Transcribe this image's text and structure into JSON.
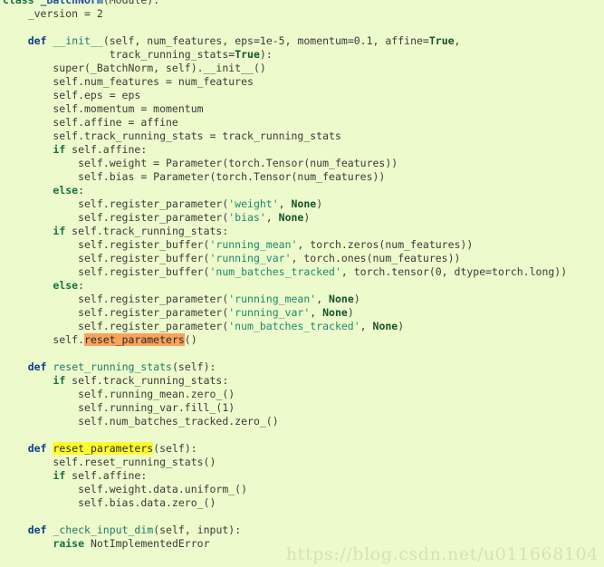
{
  "editor": {
    "background_color": "#edfacb",
    "language": "python",
    "highlight_colors": {
      "selection_orange": "#f8a25b",
      "selection_yellow": "#ffff2e"
    }
  },
  "watermark": {
    "text": "https://blog.csdn.net/u011668104",
    "color": "#d9e2b4"
  },
  "code": {
    "lines": [
      [
        {
          "t": "class",
          "c": "kw"
        },
        {
          "t": " ",
          "c": "plain"
        },
        {
          "t": "_BatchNorm",
          "c": "cls"
        },
        {
          "t": "(Module):",
          "c": "plain"
        }
      ],
      [
        {
          "t": "    _version = ",
          "c": "plain"
        },
        {
          "t": "2",
          "c": "num"
        }
      ],
      [],
      [
        {
          "t": "    ",
          "c": "plain"
        },
        {
          "t": "def",
          "c": "kwdef"
        },
        {
          "t": " ",
          "c": "plain"
        },
        {
          "t": "__init__",
          "c": "fn"
        },
        {
          "t": "(self, num_features, eps=1e-5, momentum=0.1, affine=",
          "c": "plain"
        },
        {
          "t": "True",
          "c": "const"
        },
        {
          "t": ",",
          "c": "plain"
        }
      ],
      [
        {
          "t": "                 track_running_stats=",
          "c": "plain"
        },
        {
          "t": "True",
          "c": "const"
        },
        {
          "t": "):",
          "c": "plain"
        }
      ],
      [
        {
          "t": "        super(_BatchNorm, self).__init__()",
          "c": "plain"
        }
      ],
      [
        {
          "t": "        self.num_features = num_features",
          "c": "plain"
        }
      ],
      [
        {
          "t": "        self.eps = eps",
          "c": "plain"
        }
      ],
      [
        {
          "t": "        self.momentum = momentum",
          "c": "plain"
        }
      ],
      [
        {
          "t": "        self.affine = affine",
          "c": "plain"
        }
      ],
      [
        {
          "t": "        self.track_running_stats = track_running_stats",
          "c": "plain"
        }
      ],
      [
        {
          "t": "        ",
          "c": "plain"
        },
        {
          "t": "if",
          "c": "kw"
        },
        {
          "t": " self.affine:",
          "c": "plain"
        }
      ],
      [
        {
          "t": "            self.weight = Parameter(torch.Tensor(num_features))",
          "c": "plain"
        }
      ],
      [
        {
          "t": "            self.bias = Parameter(torch.Tensor(num_features))",
          "c": "plain"
        }
      ],
      [
        {
          "t": "        ",
          "c": "plain"
        },
        {
          "t": "else",
          "c": "kw"
        },
        {
          "t": ":",
          "c": "plain"
        }
      ],
      [
        {
          "t": "            self.register_parameter(",
          "c": "plain"
        },
        {
          "t": "'weight'",
          "c": "str"
        },
        {
          "t": ", ",
          "c": "plain"
        },
        {
          "t": "None",
          "c": "const"
        },
        {
          "t": ")",
          "c": "plain"
        }
      ],
      [
        {
          "t": "            self.register_parameter(",
          "c": "plain"
        },
        {
          "t": "'bias'",
          "c": "str"
        },
        {
          "t": ", ",
          "c": "plain"
        },
        {
          "t": "None",
          "c": "const"
        },
        {
          "t": ")",
          "c": "plain"
        }
      ],
      [
        {
          "t": "        ",
          "c": "plain"
        },
        {
          "t": "if",
          "c": "kw"
        },
        {
          "t": " self.track_running_stats:",
          "c": "plain"
        }
      ],
      [
        {
          "t": "            self.register_buffer(",
          "c": "plain"
        },
        {
          "t": "'running_mean'",
          "c": "str"
        },
        {
          "t": ", torch.zeros(num_features))",
          "c": "plain"
        }
      ],
      [
        {
          "t": "            self.register_buffer(",
          "c": "plain"
        },
        {
          "t": "'running_var'",
          "c": "str"
        },
        {
          "t": ", torch.ones(num_features))",
          "c": "plain"
        }
      ],
      [
        {
          "t": "            self.register_buffer(",
          "c": "plain"
        },
        {
          "t": "'num_batches_tracked'",
          "c": "str"
        },
        {
          "t": ", torch.tensor(0, dtype=torch.long))",
          "c": "plain"
        }
      ],
      [
        {
          "t": "        ",
          "c": "plain"
        },
        {
          "t": "else",
          "c": "kw"
        },
        {
          "t": ":",
          "c": "plain"
        }
      ],
      [
        {
          "t": "            self.register_parameter(",
          "c": "plain"
        },
        {
          "t": "'running_mean'",
          "c": "str"
        },
        {
          "t": ", ",
          "c": "plain"
        },
        {
          "t": "None",
          "c": "const"
        },
        {
          "t": ")",
          "c": "plain"
        }
      ],
      [
        {
          "t": "            self.register_parameter(",
          "c": "plain"
        },
        {
          "t": "'running_var'",
          "c": "str"
        },
        {
          "t": ", ",
          "c": "plain"
        },
        {
          "t": "None",
          "c": "const"
        },
        {
          "t": ")",
          "c": "plain"
        }
      ],
      [
        {
          "t": "            self.register_parameter(",
          "c": "plain"
        },
        {
          "t": "'num_batches_tracked'",
          "c": "str"
        },
        {
          "t": ", ",
          "c": "plain"
        },
        {
          "t": "None",
          "c": "const"
        },
        {
          "t": ")",
          "c": "plain"
        }
      ],
      [
        {
          "t": "        self.",
          "c": "plain"
        },
        {
          "t": "reset_parameters",
          "c": "hl-orange"
        },
        {
          "t": "()",
          "c": "plain"
        }
      ],
      [],
      [
        {
          "t": "    ",
          "c": "plain"
        },
        {
          "t": "def",
          "c": "kwdef"
        },
        {
          "t": " ",
          "c": "plain"
        },
        {
          "t": "reset_running_stats",
          "c": "fn"
        },
        {
          "t": "(self):",
          "c": "plain"
        }
      ],
      [
        {
          "t": "        ",
          "c": "plain"
        },
        {
          "t": "if",
          "c": "kw"
        },
        {
          "t": " self.track_running_stats:",
          "c": "plain"
        }
      ],
      [
        {
          "t": "            self.running_mean.zero_()",
          "c": "plain"
        }
      ],
      [
        {
          "t": "            self.running_var.fill_(1)",
          "c": "plain"
        }
      ],
      [
        {
          "t": "            self.num_batches_tracked.zero_()",
          "c": "plain"
        }
      ],
      [],
      [
        {
          "t": "    ",
          "c": "plain"
        },
        {
          "t": "def",
          "c": "kwdef"
        },
        {
          "t": " ",
          "c": "plain"
        },
        {
          "t": "reset_parameters",
          "c": "hl-yellow"
        },
        {
          "t": "(self):",
          "c": "plain"
        }
      ],
      [
        {
          "t": "        self.reset_running_stats()",
          "c": "plain"
        }
      ],
      [
        {
          "t": "        ",
          "c": "plain"
        },
        {
          "t": "if",
          "c": "kw"
        },
        {
          "t": " self.affine:",
          "c": "plain"
        }
      ],
      [
        {
          "t": "            self.weight.data.uniform_()",
          "c": "plain"
        }
      ],
      [
        {
          "t": "            self.bias.data.zero_()",
          "c": "plain"
        }
      ],
      [],
      [
        {
          "t": "    ",
          "c": "plain"
        },
        {
          "t": "def",
          "c": "kwdef"
        },
        {
          "t": " ",
          "c": "plain"
        },
        {
          "t": "_check_input_dim",
          "c": "fn"
        },
        {
          "t": "(self, input):",
          "c": "plain"
        }
      ],
      [
        {
          "t": "        ",
          "c": "plain"
        },
        {
          "t": "raise",
          "c": "kw"
        },
        {
          "t": " NotImplementedError",
          "c": "plain"
        }
      ]
    ]
  }
}
